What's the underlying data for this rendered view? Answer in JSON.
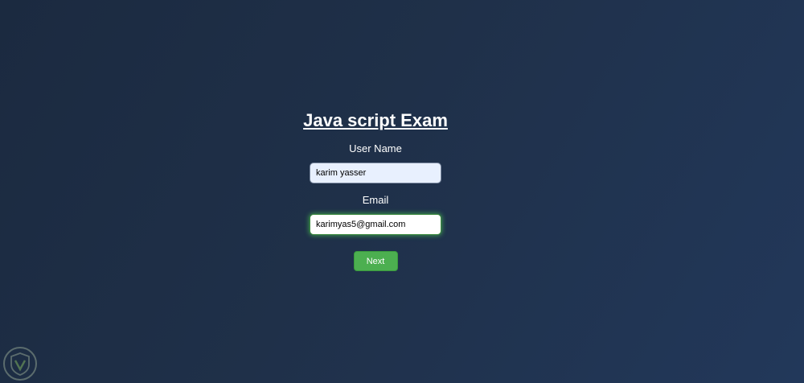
{
  "page": {
    "title": "Java script Exam"
  },
  "form": {
    "username_label": "User Name",
    "username_value": "karim yasser",
    "email_label": "Email",
    "email_value": "karimyas5@gmail.com",
    "next_label": "Next"
  },
  "colors": {
    "background": "#1f3049",
    "button": "#4caf50",
    "focus_glow": "#4cc850",
    "autofill": "#e8f0fe"
  },
  "icons": {
    "watermark": "shield-logo-icon"
  }
}
